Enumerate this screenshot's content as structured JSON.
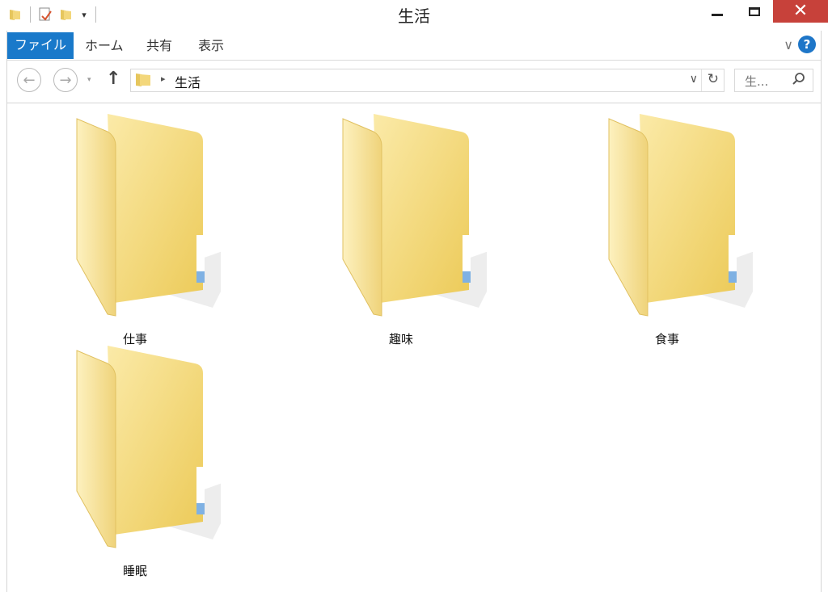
{
  "window": {
    "title": "生活",
    "close_glyph": "✕"
  },
  "quick_access": {
    "icons": [
      "folder-icon",
      "properties-icon",
      "new-folder-icon"
    ],
    "dropdown_glyph": "▾"
  },
  "ribbon": {
    "tabs": [
      {
        "label": "ファイル",
        "active": true
      },
      {
        "label": "ホーム"
      },
      {
        "label": "共有"
      },
      {
        "label": "表示"
      }
    ],
    "expand_glyph": "∨",
    "help_glyph": "?",
    "accent": "#1979ca"
  },
  "nav": {
    "back_glyph": "←",
    "forward_glyph": "→",
    "recent_glyph": "▾",
    "up_glyph": "↑",
    "breadcrumb": [
      "生活"
    ],
    "crumb_arrow": "▸",
    "dropdown_glyph": "∨",
    "refresh_glyph": "↻"
  },
  "search": {
    "placeholder": "生..."
  },
  "items": [
    {
      "name": "仕事",
      "type": "folder"
    },
    {
      "name": "趣味",
      "type": "folder"
    },
    {
      "name": "食事",
      "type": "folder"
    },
    {
      "name": "睡眠",
      "type": "folder"
    }
  ],
  "colors": {
    "close_button": "#c7413a",
    "folder_light": "#fbe9a6",
    "folder_dark": "#e9c95a"
  }
}
